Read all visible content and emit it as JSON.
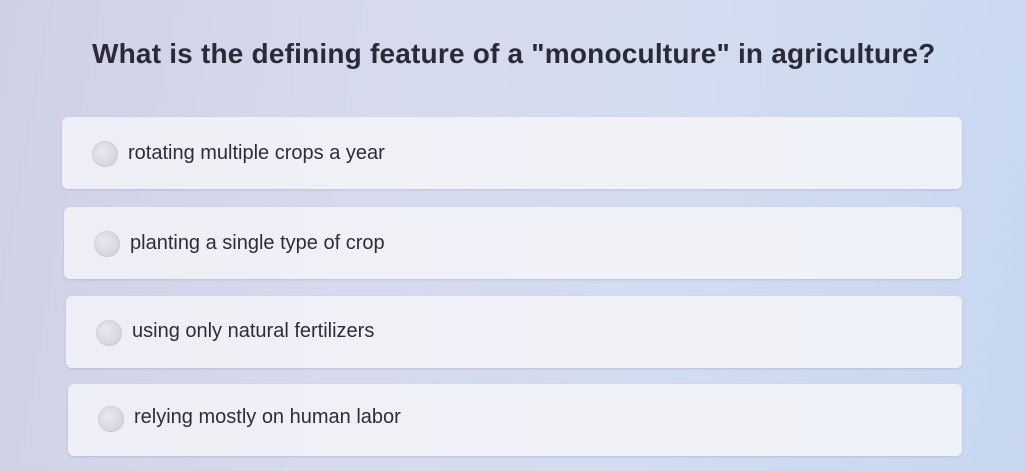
{
  "quiz": {
    "question": "What is the defining feature of a \"monoculture\" in agriculture?",
    "options": [
      {
        "label": "rotating multiple crops a year"
      },
      {
        "label": "planting a single type of crop"
      },
      {
        "label": "using only natural fertilizers"
      },
      {
        "label": "relying mostly on human labor"
      }
    ]
  }
}
